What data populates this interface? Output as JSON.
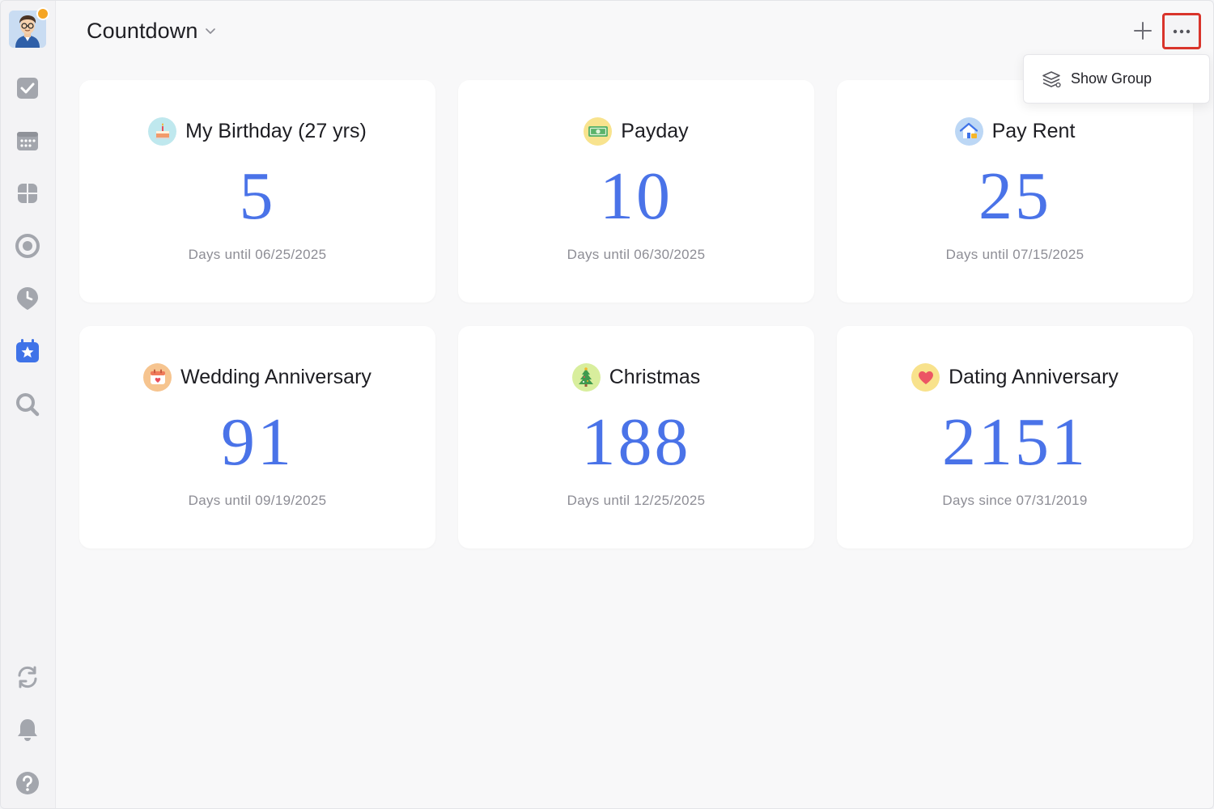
{
  "header": {
    "title": "Countdown"
  },
  "menu": {
    "show_group": "Show Group"
  },
  "cards": [
    {
      "title": "My Birthday (27 yrs)",
      "number": "5",
      "subtitle": "Days until 06/25/2025",
      "icon": "birthday-cake-icon",
      "icon_bg": "#bfe8ee"
    },
    {
      "title": "Payday",
      "number": "10",
      "subtitle": "Days until 06/30/2025",
      "icon": "money-icon",
      "icon_bg": "#f8e38e"
    },
    {
      "title": "Pay Rent",
      "number": "25",
      "subtitle": "Days until 07/15/2025",
      "icon": "house-icon",
      "icon_bg": "#bcd7f5"
    },
    {
      "title": "Wedding Anniversary",
      "number": "91",
      "subtitle": "Days until 09/19/2025",
      "icon": "calendar-heart-icon",
      "icon_bg": "#f6c48f"
    },
    {
      "title": "Christmas",
      "number": "188",
      "subtitle": "Days until 12/25/2025",
      "icon": "christmas-tree-icon",
      "icon_bg": "#d8ee9d"
    },
    {
      "title": "Dating Anniversary",
      "number": "2151",
      "subtitle": "Days since 07/31/2019",
      "icon": "heart-icon",
      "icon_bg": "#f8e28c"
    }
  ],
  "colors": {
    "accent": "#4a73e8",
    "highlight_border": "#d9342b"
  }
}
